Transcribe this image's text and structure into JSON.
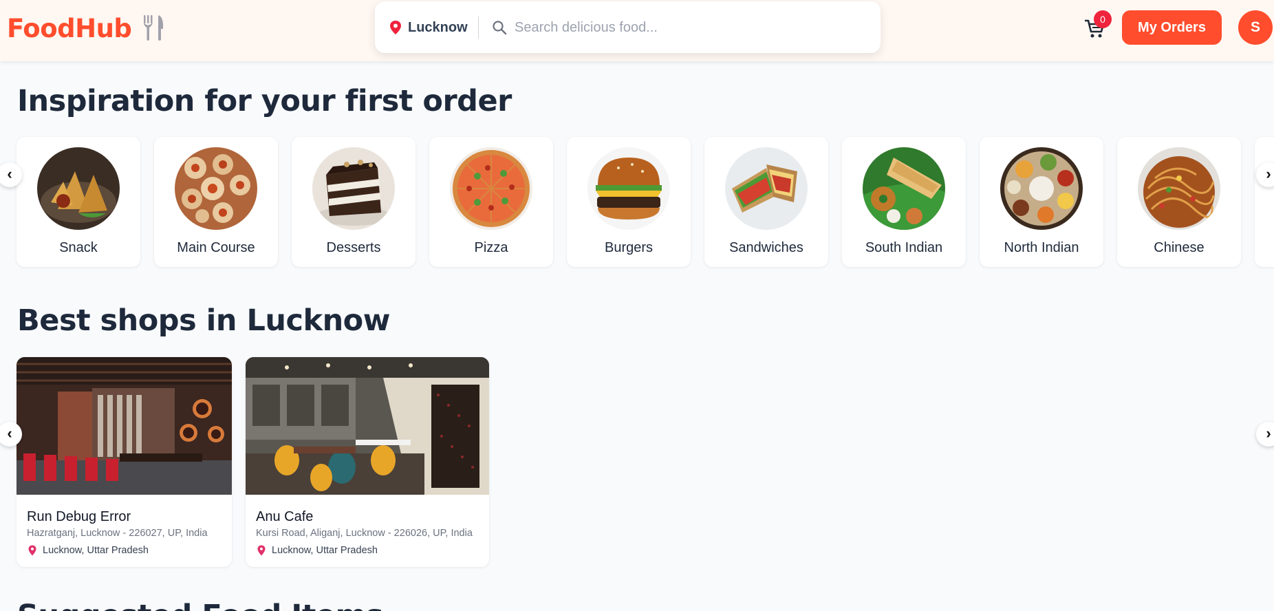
{
  "header": {
    "logo": "FoodHub",
    "logo_icon": "fork-knife-icon",
    "location": "Lucknow",
    "search_placeholder": "Search delicious food...",
    "cart_count": "0",
    "my_orders_label": "My Orders",
    "avatar_initial": "S"
  },
  "colors": {
    "brand": "#ff4d2d",
    "badge": "#ef233c",
    "header_bg": "#fff7f2",
    "page_bg": "#f8fafc"
  },
  "categories_section": {
    "title": "Inspiration for your first order",
    "items": [
      {
        "label": "Snack"
      },
      {
        "label": "Main Course"
      },
      {
        "label": "Desserts"
      },
      {
        "label": "Pizza"
      },
      {
        "label": "Burgers"
      },
      {
        "label": "Sandwiches"
      },
      {
        "label": "South Indian"
      },
      {
        "label": "North Indian"
      },
      {
        "label": "Chinese"
      }
    ]
  },
  "shops_section": {
    "title": "Best shops in Lucknow",
    "shops": [
      {
        "name": "Run Debug Error",
        "address": "Hazratganj, Lucknow - 226027, UP, India",
        "city": "Lucknow, Uttar Pradesh"
      },
      {
        "name": "Anu Cafe",
        "address": "Kursi Road, Aliganj, Lucknow - 226026, UP, India",
        "city": "Lucknow, Uttar Pradesh"
      }
    ]
  },
  "next_section": {
    "title": "Suggested Food Items"
  }
}
